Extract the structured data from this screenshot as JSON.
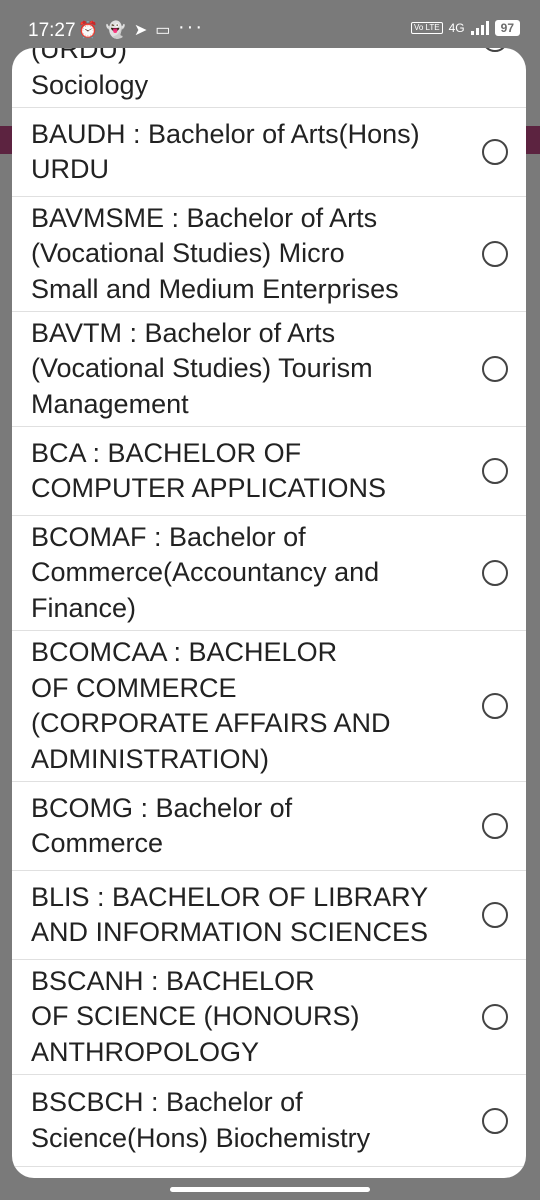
{
  "status_bar": {
    "time": "17:27",
    "network": "4G",
    "volte": "Vo LTE",
    "battery": "97",
    "more": "···"
  },
  "options": [
    {
      "label": "(URDU)\nSociology"
    },
    {
      "label": "BAUDH : Bachelor of Arts(Hons)\nURDU"
    },
    {
      "label": "BAVMSME : Bachelor of Arts\n(Vocational Studies) Micro\nSmall and Medium Enterprises"
    },
    {
      "label": "BAVTM : Bachelor of Arts\n(Vocational Studies) Tourism\nManagement"
    },
    {
      "label": "BCA : BACHELOR OF\nCOMPUTER APPLICATIONS"
    },
    {
      "label": "BCOMAF : Bachelor of\nCommerce(Accountancy and\nFinance)"
    },
    {
      "label": "BCOMCAA : BACHELOR\nOF COMMERCE\n(CORPORATE AFFAIRS AND\nADMINISTRATION)"
    },
    {
      "label": "BCOMG : Bachelor of\nCommerce"
    },
    {
      "label": "BLIS : BACHELOR OF LIBRARY\nAND INFORMATION SCIENCES"
    },
    {
      "label": "BSCANH : BACHELOR\nOF SCIENCE (HONOURS)\nANTHROPOLOGY"
    },
    {
      "label": "BSCBCH : Bachelor of\nScience(Hons) Biochemistry"
    }
  ]
}
